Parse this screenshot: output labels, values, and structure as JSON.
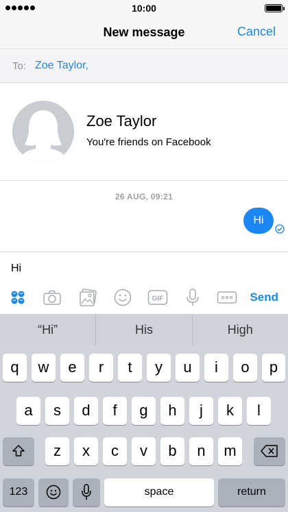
{
  "status_bar": {
    "time": "10:00"
  },
  "nav": {
    "title": "New message",
    "cancel_label": "Cancel"
  },
  "to_field": {
    "label": "To:",
    "value": "Zoe Taylor,"
  },
  "profile": {
    "name": "Zoe Taylor",
    "subtitle": "You're friends on Facebook"
  },
  "conversation": {
    "timestamp": "26 AUG, 09:21",
    "messages": [
      {
        "text": "Hi",
        "status": "read"
      }
    ]
  },
  "composer": {
    "text": "Hi",
    "send_label": "Send",
    "tools": [
      "apps-icon",
      "camera-icon",
      "gallery-icon",
      "emoji-icon",
      "gif-icon",
      "microphone-icon",
      "more-icon"
    ]
  },
  "keyboard": {
    "suggestions": [
      "“Hi”",
      "His",
      "High"
    ],
    "row1": [
      "q",
      "w",
      "e",
      "r",
      "t",
      "y",
      "u",
      "i",
      "o",
      "p"
    ],
    "row2": [
      "a",
      "s",
      "d",
      "f",
      "g",
      "h",
      "j",
      "k",
      "l"
    ],
    "row3": [
      "z",
      "x",
      "c",
      "v",
      "b",
      "n",
      "m"
    ],
    "numbers_label": "123",
    "space_label": "space",
    "return_label": "return"
  },
  "colors": {
    "accent": "#1e88e5",
    "bubble": "#1c86f2",
    "keyboard_bg": "#d1d5db"
  }
}
